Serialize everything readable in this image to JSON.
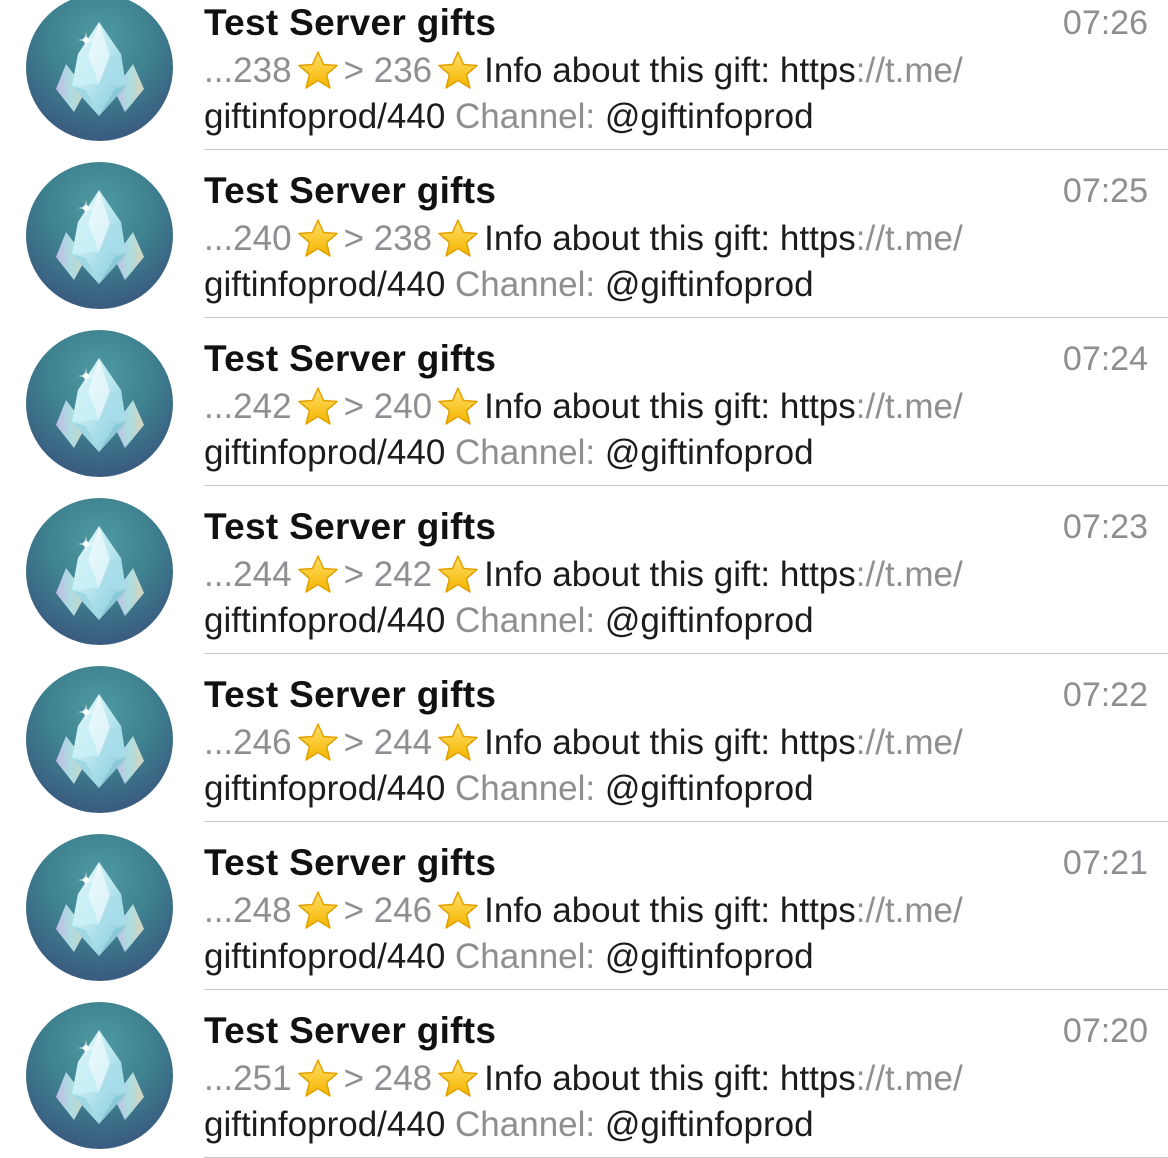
{
  "chats": [
    {
      "title": "Test Server gifts",
      "time": "07:26",
      "from": "...238",
      "to": "> 236",
      "info": "Info about this gift:",
      "url_a": "https",
      "url_b": "://t.me/",
      "url_c": "giftinfoprod/440",
      "channel_label": "Channel:",
      "channel_handle": "@giftinfoprod"
    },
    {
      "title": "Test Server gifts",
      "time": "07:25",
      "from": "...240",
      "to": "> 238",
      "info": "Info about this gift:",
      "url_a": "https",
      "url_b": "://t.me/",
      "url_c": "giftinfoprod/440",
      "channel_label": "Channel:",
      "channel_handle": "@giftinfoprod"
    },
    {
      "title": "Test Server gifts",
      "time": "07:24",
      "from": "...242",
      "to": "> 240",
      "info": "Info about this gift:",
      "url_a": "https",
      "url_b": "://t.me/",
      "url_c": "giftinfoprod/440",
      "channel_label": "Channel:",
      "channel_handle": "@giftinfoprod"
    },
    {
      "title": "Test Server gifts",
      "time": "07:23",
      "from": "...244",
      "to": "> 242",
      "info": "Info about this gift:",
      "url_a": "https",
      "url_b": "://t.me/",
      "url_c": "giftinfoprod/440",
      "channel_label": "Channel:",
      "channel_handle": "@giftinfoprod"
    },
    {
      "title": "Test Server gifts",
      "time": "07:22",
      "from": "...246",
      "to": "> 244",
      "info": "Info about this gift:",
      "url_a": "https",
      "url_b": "://t.me/",
      "url_c": "giftinfoprod/440",
      "channel_label": "Channel:",
      "channel_handle": "@giftinfoprod"
    },
    {
      "title": "Test Server gifts",
      "time": "07:21",
      "from": "...248",
      "to": "> 246",
      "info": "Info about this gift:",
      "url_a": "https",
      "url_b": "://t.me/",
      "url_c": "giftinfoprod/440",
      "channel_label": "Channel:",
      "channel_handle": "@giftinfoprod"
    },
    {
      "title": "Test Server gifts",
      "time": "07:20",
      "from": "...251",
      "to": "> 248",
      "info": "Info about this gift:",
      "url_a": "https",
      "url_b": "://t.me/",
      "url_c": "giftinfoprod/440",
      "channel_label": "Channel:",
      "channel_handle": "@giftinfoprod"
    }
  ],
  "icons": {
    "avatar": "crystal-gift-icon",
    "star": "star-emoji-icon"
  },
  "colors": {
    "title": "#111111",
    "secondary_text": "#8e8e93",
    "avatar_bg": "#3d7f8e",
    "star": "#f5c518"
  }
}
